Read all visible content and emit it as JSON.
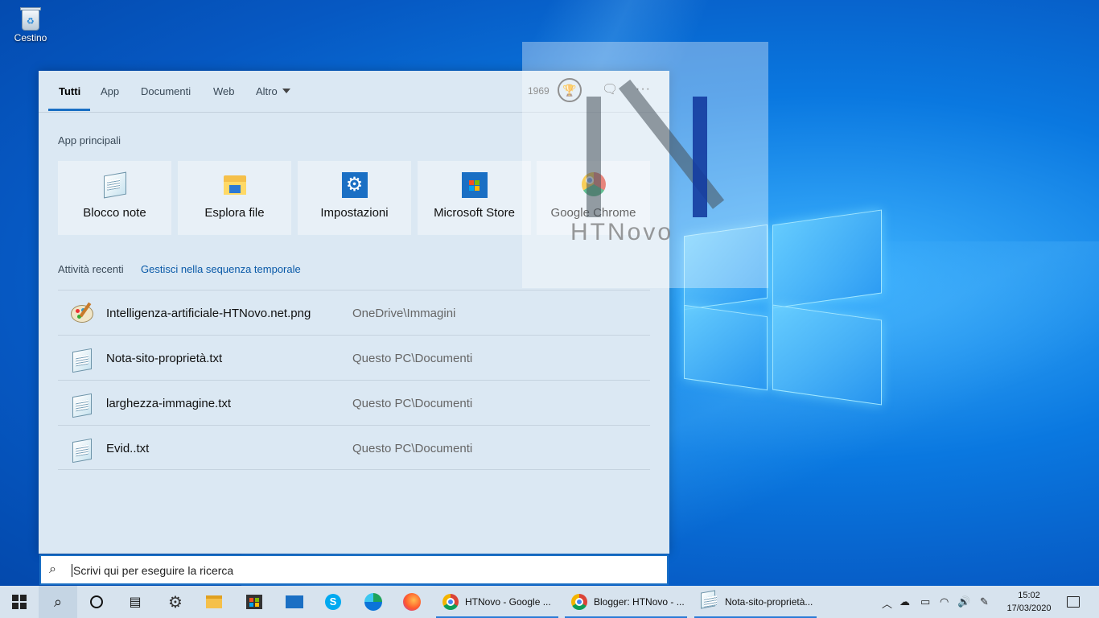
{
  "desktop": {
    "recycle_bin_label": "Cestino"
  },
  "search_panel": {
    "tabs": [
      {
        "label": "Tutti",
        "active": true
      },
      {
        "label": "App"
      },
      {
        "label": "Documenti"
      },
      {
        "label": "Web"
      },
      {
        "label": "Altro"
      }
    ],
    "rewards_points": "1969",
    "top_apps_title": "App principali",
    "top_apps": [
      {
        "label": "Blocco note",
        "icon": "notepad-icon"
      },
      {
        "label": "Esplora file",
        "icon": "file-explorer-icon"
      },
      {
        "label": "Impostazioni",
        "icon": "settings-gear-icon"
      },
      {
        "label": "Microsoft Store",
        "icon": "store-icon"
      },
      {
        "label": "Google Chrome",
        "icon": "chrome-icon"
      }
    ],
    "recent_title": "Attività recenti",
    "recent_link": "Gestisci nella sequenza temporale",
    "recent_items": [
      {
        "name": "Intelligenza-artificiale-HTNovo.net.png",
        "location": "OneDrive\\Immagini",
        "icon": "paint-icon"
      },
      {
        "name": "Nota-sito-proprietà.txt",
        "location": "Questo PC\\Documenti",
        "icon": "notepad-icon"
      },
      {
        "name": "larghezza-immagine.txt",
        "location": "Questo PC\\Documenti",
        "icon": "notepad-icon"
      },
      {
        "name": "Evid..txt",
        "location": "Questo PC\\Documenti",
        "icon": "notepad-icon"
      }
    ]
  },
  "watermark": {
    "text": "HTNovo"
  },
  "search_box": {
    "placeholder": "Scrivi qui per eseguire la ricerca"
  },
  "taskbar": {
    "apps": [
      {
        "label": "HTNovo - Google ..."
      },
      {
        "label": "Blogger: HTNovo - ..."
      },
      {
        "label": "Nota-sito-proprietà..."
      }
    ],
    "time": "15:02",
    "date": "17/03/2020"
  },
  "colors": {
    "accent": "#1a6fc4",
    "panel_bg": "#dbe8f3",
    "taskbar_bg": "#d7e3ee"
  }
}
